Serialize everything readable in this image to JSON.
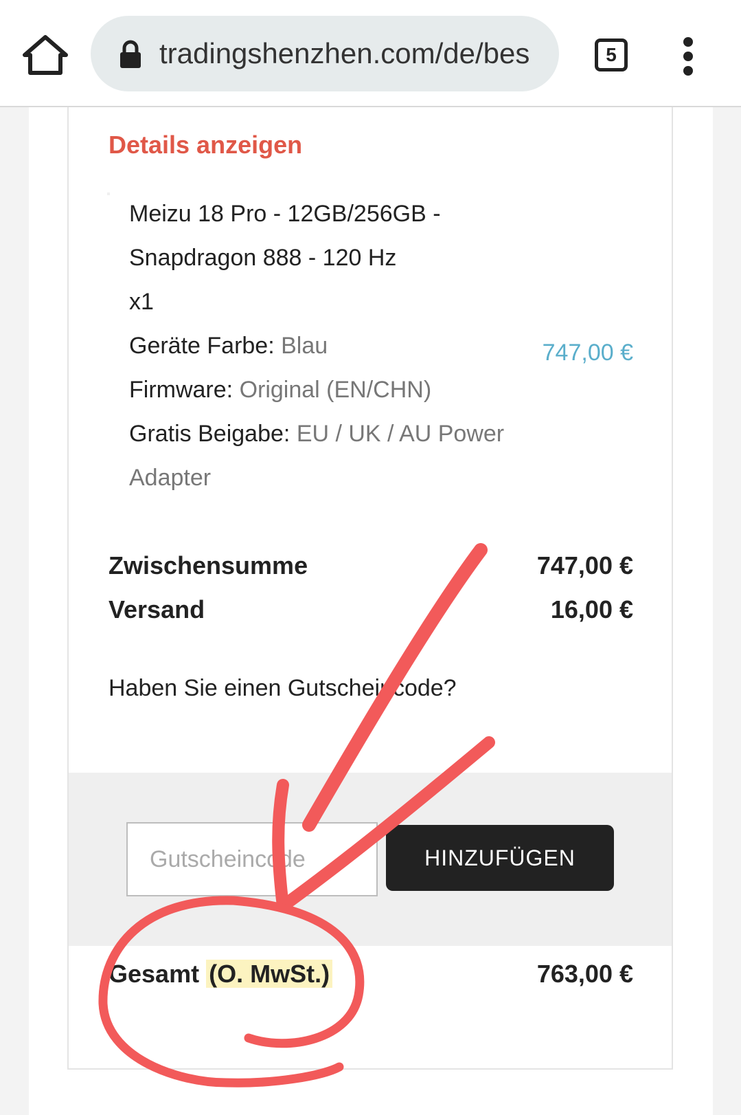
{
  "browser": {
    "url": "tradingshenzhen.com/de/bes",
    "tab_count": "5"
  },
  "order": {
    "details_link": "Details anzeigen",
    "item": {
      "name_line1": "Meizu 18 Pro - 12GB/256GB -",
      "name_line2": "Snapdragon 888 - 120 Hz",
      "quantity": "x1",
      "price": "747,00 €",
      "attributes": [
        {
          "label": "Geräte Farbe:",
          "value": "Blau"
        },
        {
          "label": "Firmware:",
          "value": "Original (EN/CHN)"
        },
        {
          "label": "Gratis Beigabe:",
          "value": "EU / UK / AU Power",
          "value_cont": "Adapter"
        }
      ]
    },
    "subtotal": {
      "label": "Zwischensumme",
      "value": "747,00 €"
    },
    "shipping": {
      "label": "Versand",
      "value": "16,00 €"
    },
    "coupon": {
      "question": "Haben Sie einen Gutscheincode?",
      "placeholder": "Gutscheincode",
      "button_label": "HINZUFÜGEN"
    },
    "total": {
      "label": "Gesamt",
      "tax_note": "(O. MwSt.)",
      "value": "763,00 €"
    }
  },
  "annotation_colors": {
    "marker": "#f25a5a",
    "highlighter": "#fcf3c0"
  }
}
